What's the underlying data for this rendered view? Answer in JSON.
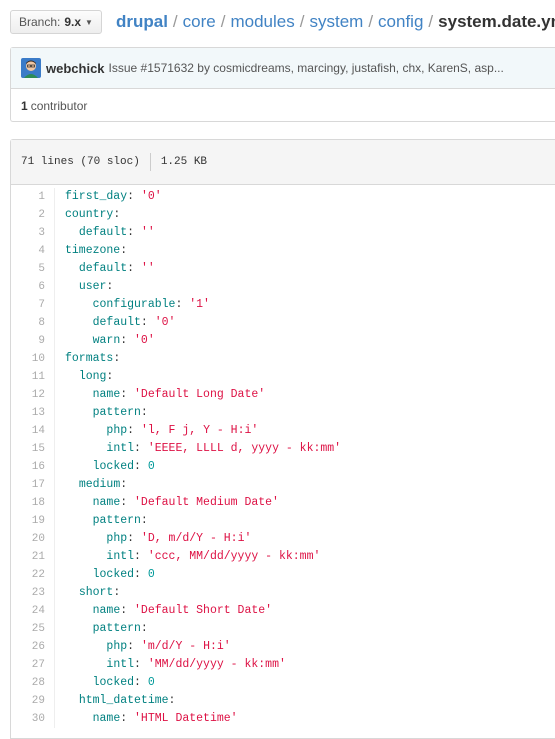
{
  "branch": {
    "label": "Branch:",
    "value": "9.x"
  },
  "breadcrumb": {
    "root": "drupal",
    "parts": [
      "core",
      "modules",
      "system",
      "config"
    ],
    "file": "system.date.yml"
  },
  "commit": {
    "author": "webchick",
    "message": "Issue #1571632 by cosmicdreams, marcingy, justafish, chx, KarenS, asp..."
  },
  "contributors": {
    "count": "1",
    "label": "contributor"
  },
  "file": {
    "lines": "71 lines (70 sloc)",
    "size": "1.25 KB"
  },
  "code": [
    {
      "n": "1",
      "indent": 0,
      "key": "first_day",
      "val": "'0'"
    },
    {
      "n": "2",
      "indent": 0,
      "key": "country",
      "val": ""
    },
    {
      "n": "3",
      "indent": 1,
      "key": "default",
      "val": "''"
    },
    {
      "n": "4",
      "indent": 0,
      "key": "timezone",
      "val": ""
    },
    {
      "n": "5",
      "indent": 1,
      "key": "default",
      "val": "''"
    },
    {
      "n": "6",
      "indent": 1,
      "key": "user",
      "val": ""
    },
    {
      "n": "7",
      "indent": 2,
      "key": "configurable",
      "val": "'1'"
    },
    {
      "n": "8",
      "indent": 2,
      "key": "default",
      "val": "'0'"
    },
    {
      "n": "9",
      "indent": 2,
      "key": "warn",
      "val": "'0'"
    },
    {
      "n": "10",
      "indent": 0,
      "key": "formats",
      "val": ""
    },
    {
      "n": "11",
      "indent": 1,
      "key": "long",
      "val": ""
    },
    {
      "n": "12",
      "indent": 2,
      "key": "name",
      "val": "'Default Long Date'"
    },
    {
      "n": "13",
      "indent": 2,
      "key": "pattern",
      "val": ""
    },
    {
      "n": "14",
      "indent": 3,
      "key": "php",
      "val": "'l, F j, Y - H:i'"
    },
    {
      "n": "15",
      "indent": 3,
      "key": "intl",
      "val": "'EEEE, LLLL d, yyyy - kk:mm'"
    },
    {
      "n": "16",
      "indent": 2,
      "key": "locked",
      "val": "0"
    },
    {
      "n": "17",
      "indent": 1,
      "key": "medium",
      "val": ""
    },
    {
      "n": "18",
      "indent": 2,
      "key": "name",
      "val": "'Default Medium Date'"
    },
    {
      "n": "19",
      "indent": 2,
      "key": "pattern",
      "val": ""
    },
    {
      "n": "20",
      "indent": 3,
      "key": "php",
      "val": "'D, m/d/Y - H:i'"
    },
    {
      "n": "21",
      "indent": 3,
      "key": "intl",
      "val": "'ccc, MM/dd/yyyy - kk:mm'"
    },
    {
      "n": "22",
      "indent": 2,
      "key": "locked",
      "val": "0"
    },
    {
      "n": "23",
      "indent": 1,
      "key": "short",
      "val": ""
    },
    {
      "n": "24",
      "indent": 2,
      "key": "name",
      "val": "'Default Short Date'"
    },
    {
      "n": "25",
      "indent": 2,
      "key": "pattern",
      "val": ""
    },
    {
      "n": "26",
      "indent": 3,
      "key": "php",
      "val": "'m/d/Y - H:i'"
    },
    {
      "n": "27",
      "indent": 3,
      "key": "intl",
      "val": "'MM/dd/yyyy - kk:mm'"
    },
    {
      "n": "28",
      "indent": 2,
      "key": "locked",
      "val": "0"
    },
    {
      "n": "29",
      "indent": 1,
      "key": "html_datetime",
      "val": ""
    },
    {
      "n": "30",
      "indent": 2,
      "key": "name",
      "val": "'HTML Datetime'"
    }
  ],
  "colors": {
    "link": "#4183c4",
    "key": "#008080",
    "string": "#d14"
  }
}
